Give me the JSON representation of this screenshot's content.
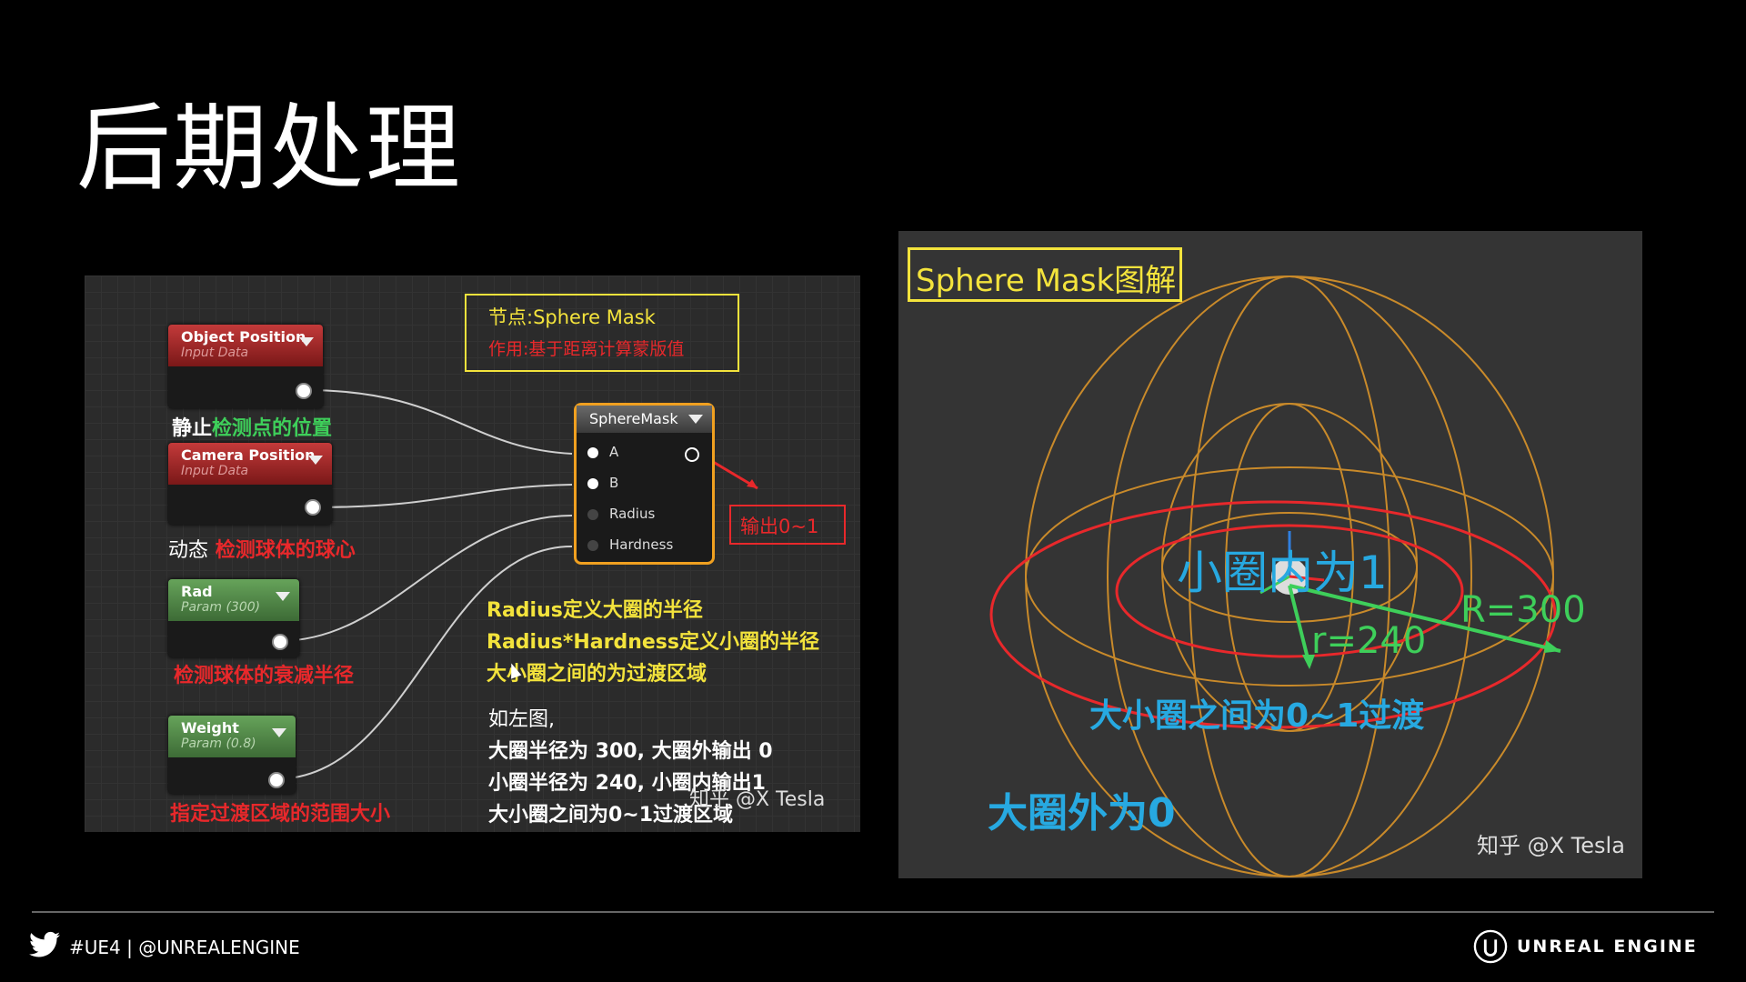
{
  "slide_title": "后期处理",
  "left_panel": {
    "nodes": [
      {
        "title": "Object Position",
        "subtitle": "Input Data"
      },
      {
        "title": "Camera Position",
        "subtitle": "Input Data"
      },
      {
        "title": "Rad",
        "subtitle": "Param (300)"
      },
      {
        "title": "Weight",
        "subtitle": "Param (0.8)"
      }
    ],
    "captions": {
      "object_static": "静止",
      "object_desc": "检测点的位置",
      "camera_dynamic": "动态",
      "camera_desc": "检测球体的球心",
      "rad_desc": "检测球体的衰减半径",
      "weight_desc": "指定过渡区域的范围大小"
    },
    "info_box": {
      "line1": "节点:Sphere Mask",
      "line2": "作用:基于距离计算蒙版值"
    },
    "sphere_mask": {
      "title": "SphereMask",
      "pins": [
        "A",
        "B",
        "Radius",
        "Hardness"
      ]
    },
    "output_label": "输出0~1",
    "yellow_notes": [
      "Radius定义大圈的半径",
      "Radius*Hardness定义小圈的半径",
      "大小圈之间的为过渡区域"
    ],
    "white_notes": [
      "如左图,",
      "大圈半径为 300, 大圈外输出 0",
      "小圈半径为 240, 小圈内输出1",
      "大小圈之间为0~1过渡区域"
    ],
    "watermark": "知乎 @X Tesla"
  },
  "right_panel": {
    "title": "Sphere Mask图解",
    "inner_label": "小圈内为1",
    "R_label": "R=300",
    "r_label": "r=240",
    "transition_label": "大小圈之间为0~1过渡",
    "outer_label": "大圈外为0",
    "watermark": "知乎 @X Tesla"
  },
  "footer": {
    "left_text": "#UE4 | @UNREALENGINE",
    "right_text": "UNREAL ENGINE"
  },
  "colors": {
    "yellow": "#f3e33c",
    "red": "#e8282b",
    "green": "#3ecf5a",
    "cyan": "#27a9e1",
    "orange": "#c98a2a"
  }
}
